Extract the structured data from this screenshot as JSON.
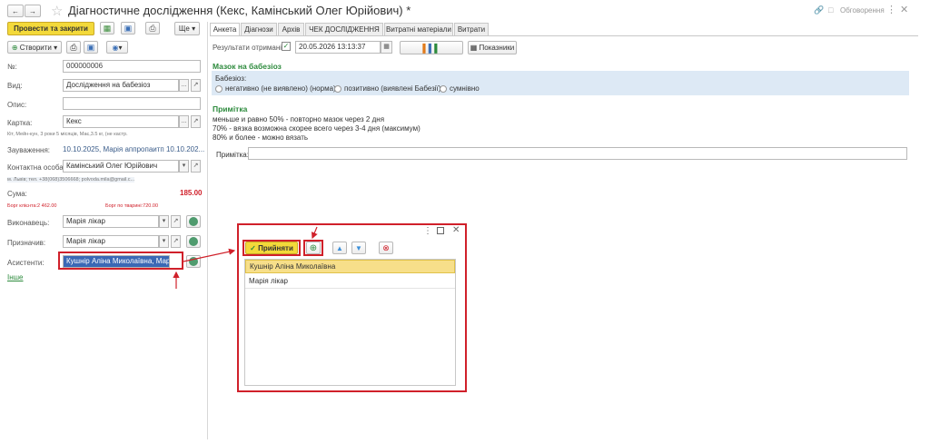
{
  "window": {
    "title": "Діагностичне дослідження (Кекс, Камінський Олег Юрійович) *",
    "notifications": "Обговорення"
  },
  "toolbar": {
    "post_close": "Провести та закрити",
    "create": "Створити",
    "more": "Ще"
  },
  "form": {
    "number_label": "№:",
    "number": "000000006",
    "type_label": "Вид:",
    "type": "Дослідження на бабезіоз",
    "description_label": "Опис:",
    "card_label": "Картка:",
    "card": "Кекс",
    "card_info": "Кіт, Мейн-кун, 3 роки 5 місяців, Має,3.5 кг, (не кастр.",
    "remark_label": "Зауваження:",
    "remark": "10.10.2025, Марія аппропаитп 10.10.202...",
    "contact_label": "Контактна особа:",
    "contact": "Камінський Олег Юрійович",
    "contact_info": "м. Львів; тел. +38(068)3506668; polvoda.mila@gmail.c...",
    "sum_label": "Сума:",
    "sum": "185.00",
    "client_debt": "Борг клієнта:2 462.00",
    "animal_debt": "Борг по тварині:720.00",
    "executor_label": "Виконавець:",
    "executor": "Марія лікар",
    "assigned_label": "Призначив:",
    "assigned": "Марія лікар",
    "assistants_label": "Асистенти:",
    "assistants": "Кушнір Аліна Миколаївна, Марія",
    "other_link": "Інше"
  },
  "tabs": [
    "Анкета",
    "Діагнози",
    "Архів",
    "ЧЕК ДОСЛІДЖЕННЯ",
    "Витратні матеріали",
    "Витрати"
  ],
  "anketa": {
    "results_label": "Результати отримані:",
    "results_datetime": "20.05.2026 13:13:37",
    "indicators_btn": "Показники",
    "section_title": "Мазок на бабезіоз",
    "babesiosis_label": "Бабезіоз:",
    "options": [
      "негативно (не виявлено) (норма)",
      "позитивно (виявлені Бабезії)",
      "сумнівно"
    ],
    "note_title": "Примітка",
    "note_lines": [
      "меньше и равно 50% - повторно мазок через 2 дня",
      "70% - вязка возможна скорее всего через 3-4 дня (максимум)",
      "80% и более - можно вязать"
    ],
    "note_field_label": "Примітка:"
  },
  "popup": {
    "accept": "Прийняти",
    "items": [
      "Кушнір Аліна Миколаївна",
      "Марія лікар"
    ]
  },
  "colors": {
    "accent_yellow": "#f3d93a",
    "highlight": "#dde9f5",
    "annotation_red": "#d0202a",
    "section_green": "#2c8a3c"
  }
}
